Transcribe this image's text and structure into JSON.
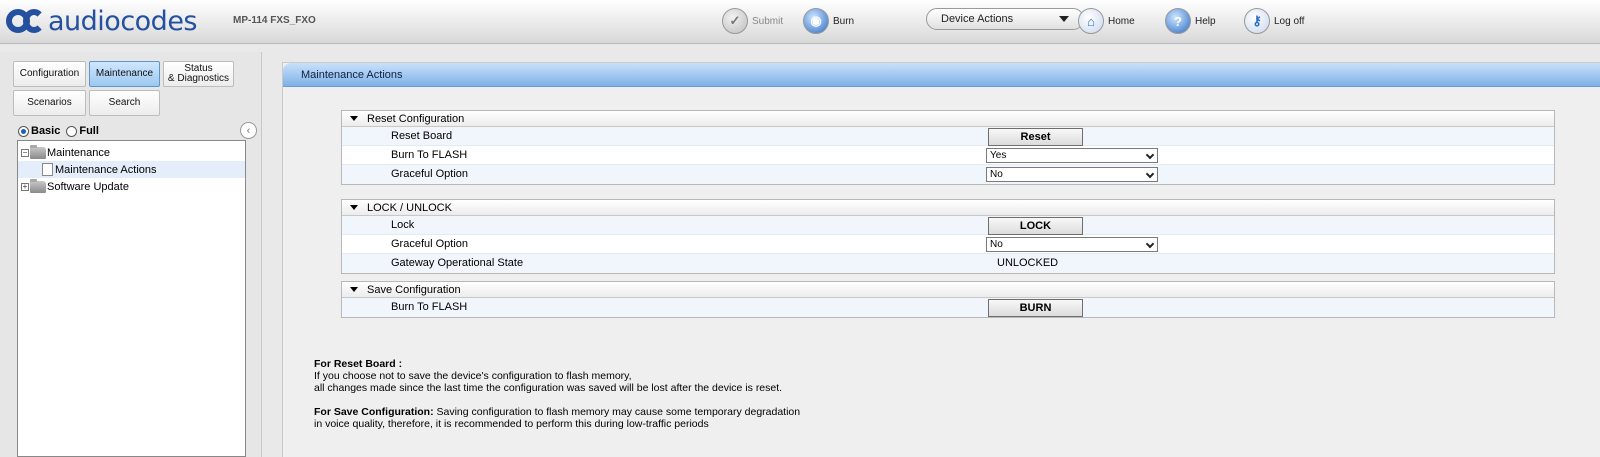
{
  "header": {
    "brand": "audiocodes",
    "model": "MP-114 FXS_FXO",
    "submit_label": "Submit",
    "burn_label": "Burn",
    "device_actions_label": "Device Actions",
    "home_label": "Home",
    "help_label": "Help",
    "logoff_label": "Log off",
    "icons": {
      "submit": "checkmark-icon",
      "burn": "burn-disc-icon",
      "home": "home-icon",
      "help": "help-icon",
      "logoff": "key-icon"
    }
  },
  "nav": {
    "tabs": {
      "configuration": "Configuration",
      "maintenance": "Maintenance",
      "status_line1": "Status",
      "status_line2": "& Diagnostics",
      "scenarios": "Scenarios",
      "search": "Search"
    },
    "active_tab": "Maintenance",
    "mode_basic": "Basic",
    "mode_full": "Full",
    "selected_mode": "Basic",
    "tree": {
      "maintenance": "Maintenance",
      "maintenance_actions": "Maintenance Actions",
      "software_update": "Software Update"
    }
  },
  "main": {
    "title": "Maintenance Actions",
    "reset_section": {
      "title": "Reset Configuration",
      "reset_board_label": "Reset Board",
      "reset_button": "Reset",
      "burn_to_flash_label": "Burn To FLASH",
      "burn_to_flash_value": "Yes",
      "graceful_option_label": "Graceful Option",
      "graceful_option_value": "No"
    },
    "lock_section": {
      "title": "LOCK / UNLOCK",
      "lock_label": "Lock",
      "lock_button": "LOCK",
      "graceful_option_label": "Graceful Option",
      "graceful_option_value": "No",
      "gateway_state_label": "Gateway Operational State",
      "gateway_state_value": "UNLOCKED"
    },
    "save_section": {
      "title": "Save Configuration",
      "burn_to_flash_label": "Burn To FLASH",
      "burn_button": "BURN"
    },
    "notes": {
      "reset_heading": "For Reset Board :",
      "reset_line1": "If you choose not to save the device's configuration to flash memory,",
      "reset_line2": "all changes made since the last time the configuration was saved will be lost after the device is reset.",
      "save_heading": "For Save Configuration:",
      "save_line1": " Saving configuration to flash memory may cause some temporary degradation",
      "save_line2": "in voice quality, therefore, it is recommended to perform this during low-traffic periods"
    }
  }
}
